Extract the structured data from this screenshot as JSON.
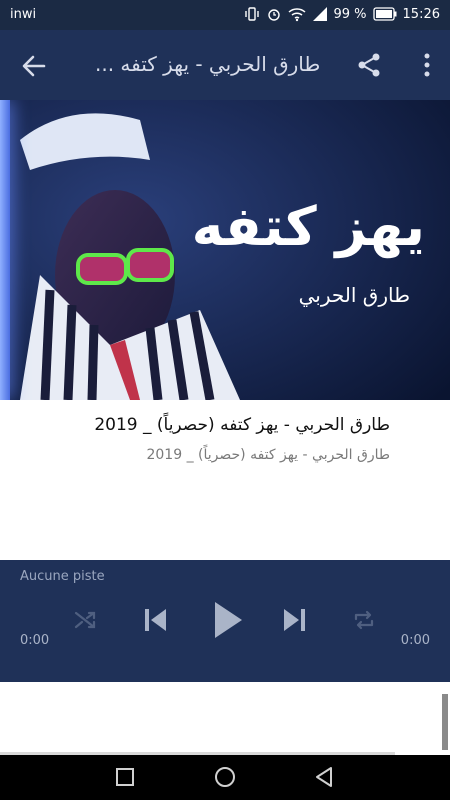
{
  "status_bar": {
    "carrier": "inwi",
    "battery": "99 %",
    "time": "15:26"
  },
  "app_bar": {
    "title": "طارق الحربي - يهز كتفه ..."
  },
  "video": {
    "overlay_title": "يهز كتفه",
    "overlay_artist": "طارق الحربي"
  },
  "track": {
    "title": "طارق الحربي - يهز كتفه (حصرياً) _ 2019",
    "subtitle": "طارق الحربي - يهز كتفه (حصرياً) _ 2019"
  },
  "player": {
    "no_track": "Aucune piste",
    "elapsed": "0:00",
    "duration": "0:00"
  },
  "colors": {
    "app_bar": "#1f3158",
    "status_bar": "#1b2a44",
    "player_bg": "#1f3158"
  }
}
